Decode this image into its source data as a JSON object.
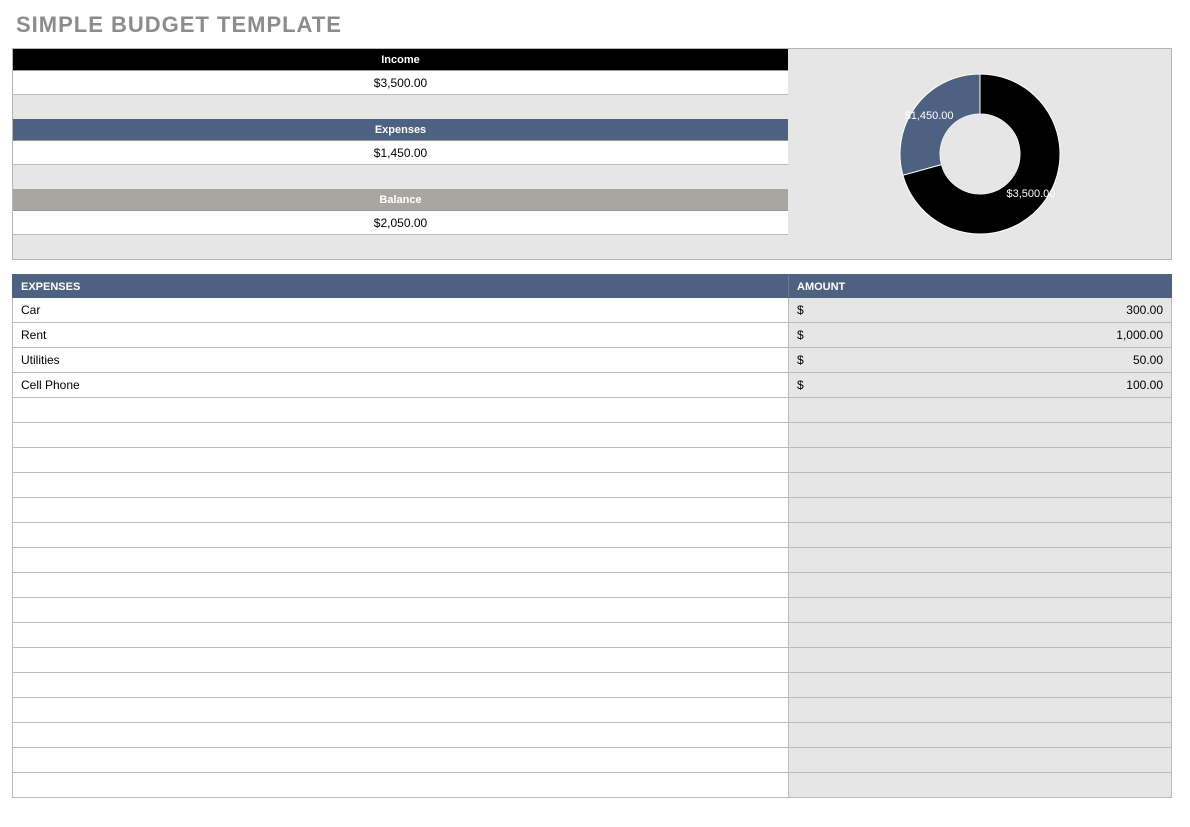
{
  "title": "SIMPLE BUDGET TEMPLATE",
  "summary": {
    "income": {
      "label": "Income",
      "value": "$3,500.00"
    },
    "expenses": {
      "label": "Expenses",
      "value": "$1,450.00"
    },
    "balance": {
      "label": "Balance",
      "value": "$2,050.00"
    }
  },
  "chart_data": {
    "type": "pie",
    "series": [
      {
        "name": "Income",
        "value": 3500,
        "label": "$3,500.00",
        "color": "#000000"
      },
      {
        "name": "Expenses",
        "value": 1450,
        "label": "$1,450.00",
        "color": "#4e6181"
      }
    ]
  },
  "table": {
    "headers": {
      "expenses": "EXPENSES",
      "amount": "AMOUNT"
    },
    "currency_symbol": "$",
    "rows": [
      {
        "label": "Car",
        "amount": "300.00"
      },
      {
        "label": "Rent",
        "amount": "1,000.00"
      },
      {
        "label": "Utilities",
        "amount": "50.00"
      },
      {
        "label": "Cell Phone",
        "amount": "100.00"
      }
    ],
    "empty_rows": 16
  }
}
